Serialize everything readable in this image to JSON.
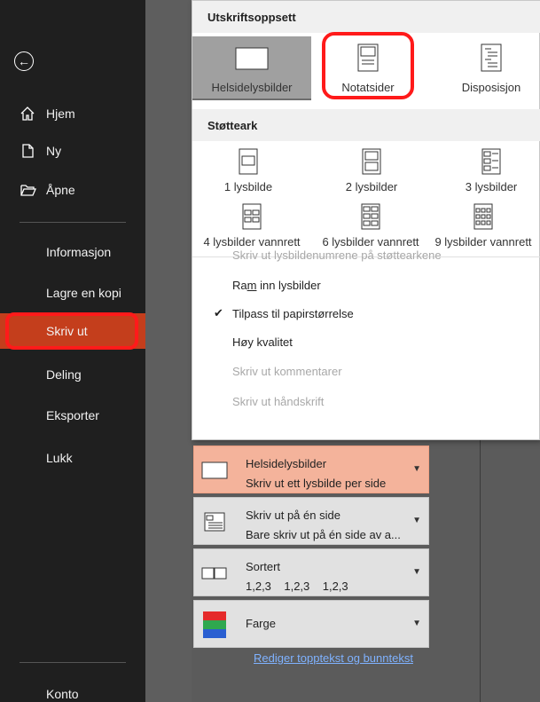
{
  "sidebar": {
    "back_label": "",
    "items": [
      {
        "label": "Hjem",
        "icon": "home-icon"
      },
      {
        "label": "Ny",
        "icon": "new-document-icon"
      },
      {
        "label": "Åpne",
        "icon": "folder-open-icon"
      }
    ],
    "secondary": [
      {
        "label": "Informasjon"
      },
      {
        "label": "Lagre en kopi"
      },
      {
        "label": "Skriv ut",
        "selected": true
      },
      {
        "label": "Deling"
      },
      {
        "label": "Eksporter"
      },
      {
        "label": "Lukk"
      }
    ],
    "bottom": {
      "label": "Konto"
    }
  },
  "popup": {
    "layout_header": "Utskriftsoppsett",
    "layouts": [
      {
        "label": "Helsidelysbilder",
        "selected": true
      },
      {
        "label": "Notatsider"
      },
      {
        "label": "Disposisjon"
      }
    ],
    "handouts_header": "Støtteark",
    "handouts": [
      {
        "label": "1 lysbilde"
      },
      {
        "label": "2 lysbilder"
      },
      {
        "label": "3 lysbilder"
      },
      {
        "label": "4 lysbilder vannrett"
      },
      {
        "label": "6 lysbilder vannrett"
      },
      {
        "label": "9 lysbilder vannrett"
      }
    ],
    "options": [
      {
        "label": "Skriv ut lysbildenumrene på støttearkene",
        "disabled": true,
        "checked": false
      },
      {
        "label_pre": "Ra",
        "label_u": "m",
        "label_post": " inn lysbilder",
        "disabled": false,
        "checked": false
      },
      {
        "label": "Tilpass til papirstørrelse",
        "disabled": false,
        "checked": true
      },
      {
        "label": "Høy kvalitet",
        "disabled": false,
        "checked": false
      },
      {
        "label": "Skriv ut kommentarer",
        "disabled": true,
        "checked": false
      },
      {
        "label": "Skriv ut håndskrift",
        "disabled": true,
        "checked": false
      }
    ]
  },
  "settings": {
    "layout_dd": {
      "title": "Helsidelysbilder",
      "sub": "Skriv ut ett lysbilde per side"
    },
    "sides_dd": {
      "title": "Skriv ut på én side",
      "sub": "Bare skriv ut på én side av a..."
    },
    "collate_dd": {
      "title": "Sortert",
      "sub": "1,2,3    1,2,3    1,2,3"
    },
    "color_dd": {
      "title": "Farge"
    },
    "edit_link": "Rediger topptekst og bunntekst"
  },
  "colors": {
    "sidebar_bg": "#1f1f1f",
    "selected_nav": "#c43e1c",
    "highlight_ring": "#ff1a1a",
    "active_dropdown": "#f4b39b"
  }
}
